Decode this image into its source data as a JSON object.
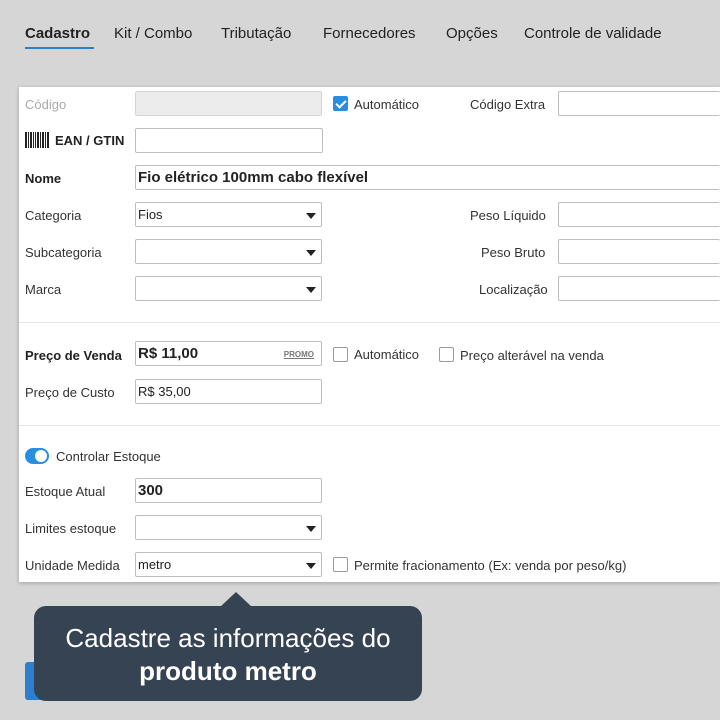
{
  "tabs": [
    {
      "label": "Cadastro",
      "active": true
    },
    {
      "label": "Kit / Combo"
    },
    {
      "label": "Tributação"
    },
    {
      "label": "Fornecedores"
    },
    {
      "label": "Opções"
    },
    {
      "label": "Controle de validade"
    }
  ],
  "form": {
    "codigo_label": "Código",
    "codigo_value": "",
    "automatico_label": "Automático",
    "automatico_checked": true,
    "codigo_extra_label": "Código Extra",
    "codigo_extra_value": "",
    "ean_label": "EAN / GTIN",
    "ean_value": "",
    "nome_label": "Nome",
    "nome_value": "Fio elétrico 100mm cabo flexível",
    "categoria_label": "Categoria",
    "categoria_value": "Fios",
    "subcategoria_label": "Subcategoria",
    "subcategoria_value": "",
    "marca_label": "Marca",
    "marca_value": "",
    "peso_liquido_label": "Peso Líquido",
    "peso_liquido_value": "",
    "peso_bruto_label": "Peso Bruto",
    "peso_bruto_value": "",
    "localizacao_label": "Localização",
    "localizacao_value": "",
    "preco_venda_label": "Preço de Venda",
    "preco_venda_value": "R$ 11,00",
    "promo_label": "PROMO",
    "preco_automatico_label": "Automático",
    "preco_alteravel_label": "Preço alterável na venda",
    "preco_custo_label": "Preço de Custo",
    "preco_custo_value": "R$ 35,00",
    "controlar_estoque_label": "Controlar Estoque",
    "controlar_estoque_on": true,
    "estoque_atual_label": "Estoque Atual",
    "estoque_atual_value": "300",
    "limites_estoque_label": "Limites estoque",
    "limites_estoque_value": "",
    "unidade_medida_label": "Unidade Medida",
    "unidade_medida_value": "metro",
    "fracionamento_label": "Permite fracionamento (Ex: venda por peso/kg)"
  },
  "tooltip": {
    "line1": "Cadastre as informações do",
    "line2": "produto metro"
  },
  "colors": {
    "accent": "#2a7fd0",
    "tooltip_bg": "#364352",
    "page_bg": "#d6d6d6"
  }
}
